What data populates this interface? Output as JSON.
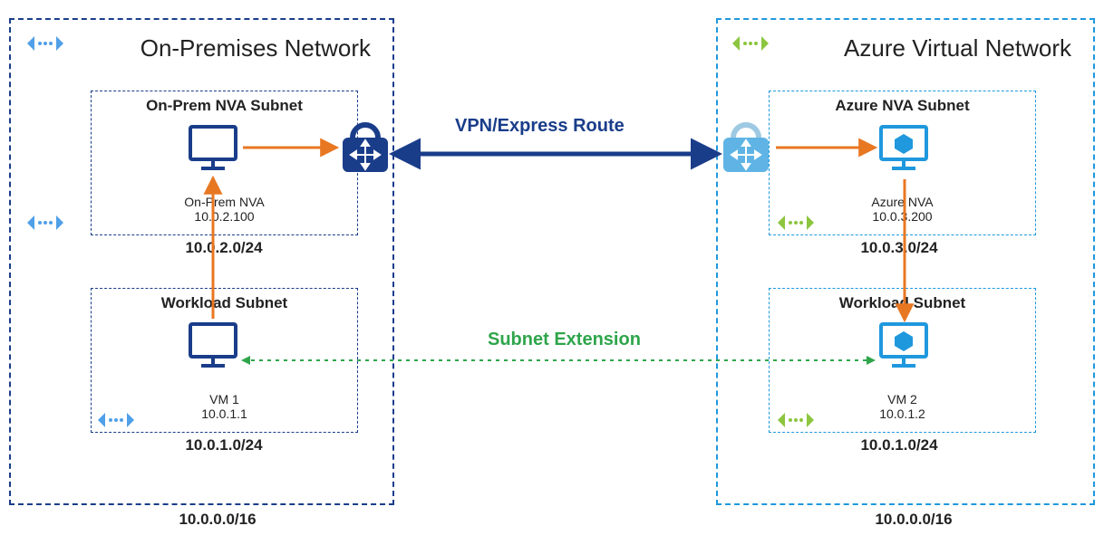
{
  "diagram": {
    "onprem": {
      "title": "On-Premises Network",
      "cidr": "10.0.0.0/16",
      "nva_subnet": {
        "title": "On-Prem NVA Subnet",
        "device": "On-Prem NVA",
        "ip": "10.0.2.100",
        "cidr": "10.0.2.0/24"
      },
      "workload_subnet": {
        "title": "Workload Subnet",
        "device": "VM 1",
        "ip": "10.0.1.1",
        "cidr": "10.0.1.0/24"
      }
    },
    "azure": {
      "title": "Azure Virtual Network",
      "cidr": "10.0.0.0/16",
      "nva_subnet": {
        "title": "Azure NVA Subnet",
        "device": "Azure NVA",
        "ip": "10.0.3.200",
        "cidr": "10.0.3.0/24"
      },
      "workload_subnet": {
        "title": "Workload Subnet",
        "device": "VM 2",
        "ip": "10.0.1.2",
        "cidr": "10.0.1.0/24"
      }
    },
    "connections": {
      "vpn_label": "VPN/Express Route",
      "extension_label": "Subnet Extension"
    }
  }
}
